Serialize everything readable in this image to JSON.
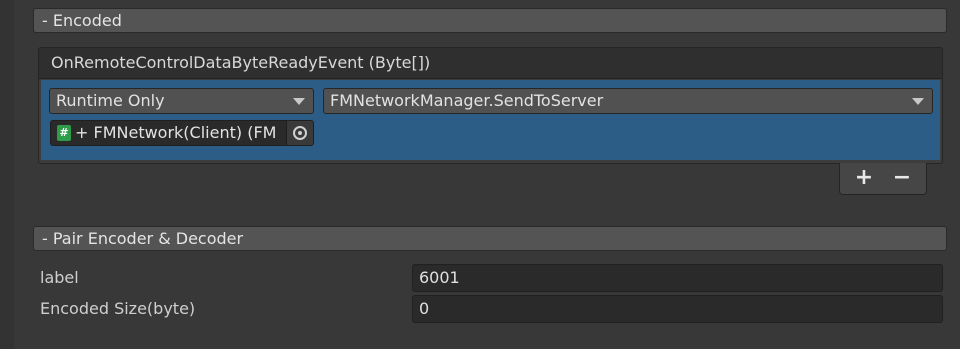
{
  "sections": {
    "encoded": {
      "header": "- Encoded"
    },
    "pair": {
      "header": "- Pair Encoder & Decoder"
    }
  },
  "event": {
    "title": "OnRemoteControlDataByteReadyEvent (Byte[])",
    "call_state": "Runtime Only",
    "function": "FMNetworkManager.SendToServer",
    "target_object": "+ FMNetwork(Client) (FM",
    "target_icon": "#",
    "add_label": "+",
    "remove_label": "−"
  },
  "fields": [
    {
      "label": "label",
      "value": "6001"
    },
    {
      "label": "Encoded Size(byte)",
      "value": "0"
    }
  ],
  "colors": {
    "background": "#383838",
    "selected_row": "#2c5d87",
    "header": "#545454",
    "script_icon": "#2f9c4a"
  }
}
